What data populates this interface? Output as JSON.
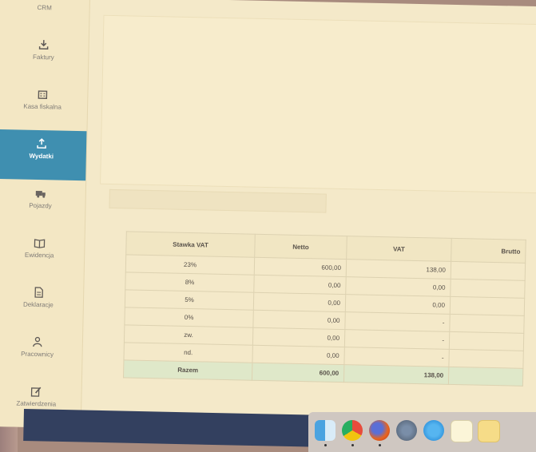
{
  "sidebar": {
    "items": [
      {
        "label": "CRM",
        "icon": "crm-icon",
        "active": false
      },
      {
        "label": "Faktury",
        "icon": "invoice-icon",
        "active": false
      },
      {
        "label": "Kasa fiskalna",
        "icon": "cash-register-icon",
        "active": false
      },
      {
        "label": "Wydatki",
        "icon": "expenses-icon",
        "active": true
      },
      {
        "label": "Pojazdy",
        "icon": "vehicle-icon",
        "active": false
      },
      {
        "label": "Ewidencja",
        "icon": "ledger-icon",
        "active": false
      },
      {
        "label": "Deklaracje",
        "icon": "document-icon",
        "active": false
      },
      {
        "label": "Pracownicy",
        "icon": "employees-icon",
        "active": false
      },
      {
        "label": "Zatwierdzenia",
        "icon": "edit-icon",
        "active": false
      }
    ]
  },
  "vat_table": {
    "headers": [
      "Stawka VAT",
      "Netto",
      "VAT",
      "Brutto"
    ],
    "rows": [
      {
        "rate": "23%",
        "netto": "600,00",
        "vat": "138,00"
      },
      {
        "rate": "8%",
        "netto": "0,00",
        "vat": "0,00"
      },
      {
        "rate": "5%",
        "netto": "0,00",
        "vat": "0,00"
      },
      {
        "rate": "0%",
        "netto": "0,00",
        "vat": "-"
      },
      {
        "rate": "zw.",
        "netto": "0,00",
        "vat": "-"
      },
      {
        "rate": "nd.",
        "netto": "0,00",
        "vat": "-"
      }
    ],
    "total": {
      "label": "Razem",
      "netto": "600,00",
      "vat": "138,00"
    }
  },
  "dock": {
    "icons": [
      "finder-icon",
      "chrome-icon",
      "firefox-icon",
      "launchpad-icon",
      "app-store-icon",
      "notes-icon",
      "stickies-icon"
    ]
  },
  "colors": {
    "active_nav": "#3f8fb0",
    "total_row": "#dfe8c9",
    "taskbar": "#33405f"
  }
}
